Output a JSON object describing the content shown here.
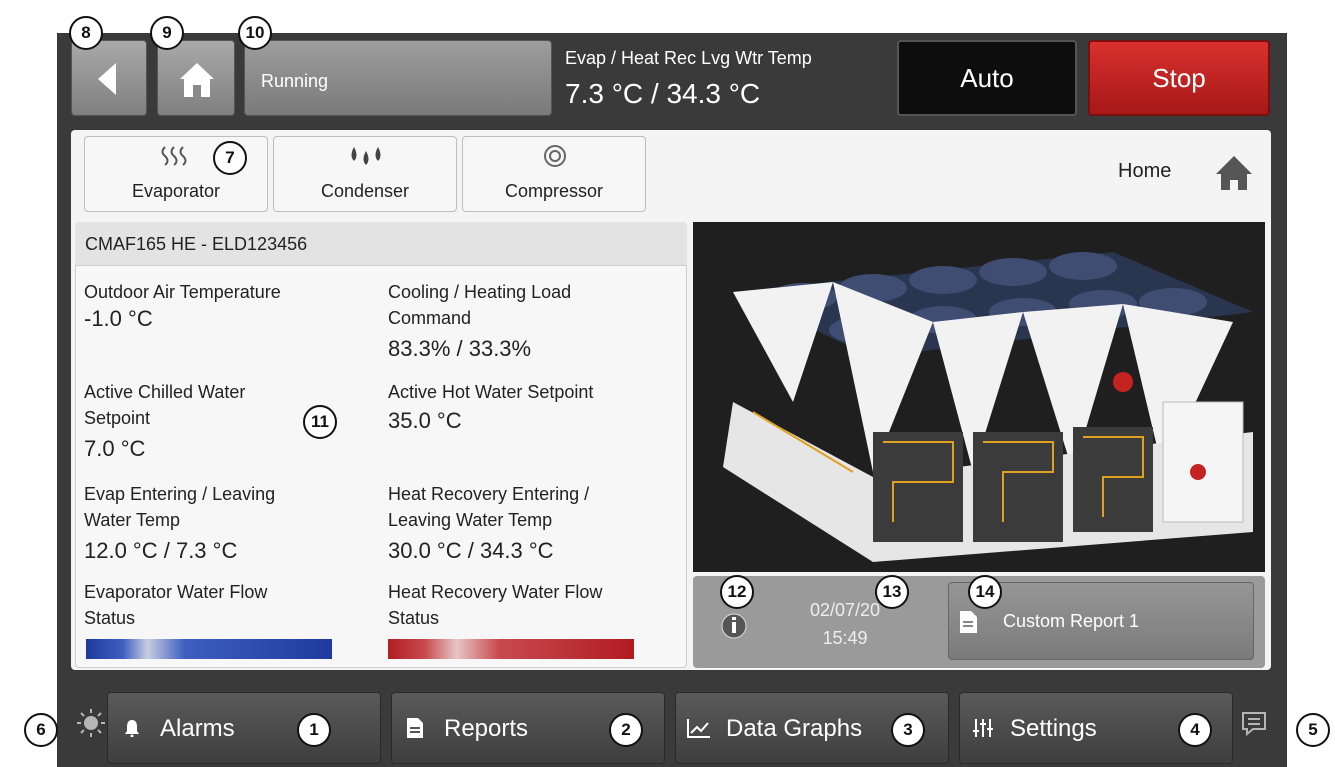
{
  "header": {
    "status_text": "Running",
    "temp_label": "Evap / Heat Rec Lvg Wtr Temp",
    "temp_value": "7.3 °C / 34.3 °C",
    "auto_label": "Auto",
    "stop_label": "Stop"
  },
  "tabs": [
    {
      "label": "Evaporator",
      "icon": "steam-icon"
    },
    {
      "label": "Condenser",
      "icon": "droplets-icon"
    },
    {
      "label": "Compressor",
      "icon": "spiral-icon"
    }
  ],
  "home_label": "Home",
  "unit": {
    "title": "CMAF165 HE - ELD123456",
    "outdoor_air_label": "Outdoor Air Temperature",
    "outdoor_air_value": "-1.0 °C",
    "load_label_1": "Cooling / Heating Load",
    "load_label_2": "Command",
    "load_value": "83.3% / 33.3%",
    "chilled_sp_label_1": "Active Chilled Water",
    "chilled_sp_label_2": "Setpoint",
    "chilled_sp_value": "7.0 °C",
    "hot_sp_label": "Active Hot Water Setpoint",
    "hot_sp_value": "35.0 °C",
    "evap_temp_label_1": "Evap Entering / Leaving",
    "evap_temp_label_2": "Water Temp",
    "evap_temp_value": "12.0 °C / 7.3 °C",
    "hr_temp_label_1": "Heat Recovery Entering /",
    "hr_temp_label_2": "Leaving Water Temp",
    "hr_temp_value": "30.0 °C / 34.3 °C",
    "evap_flow_label_1": "Evaporator Water Flow",
    "evap_flow_label_2": "Status",
    "hr_flow_label_1": "Heat Recovery Water Flow",
    "hr_flow_label_2": "Status"
  },
  "info": {
    "date": "02/07/20",
    "time": "15:49",
    "report_label": "Custom Report 1"
  },
  "bottom_nav": {
    "alarms": "Alarms",
    "reports": "Reports",
    "data_graphs": "Data Graphs",
    "settings": "Settings"
  },
  "callouts": [
    "1",
    "2",
    "3",
    "4",
    "5",
    "6",
    "7",
    "8",
    "9",
    "10",
    "11",
    "12",
    "13",
    "14"
  ],
  "colors": {
    "stop": "#c42322",
    "auto": "#0d0d0d",
    "evap_flow_bar": "#1e3a9c",
    "hr_flow_bar": "#b01c22"
  }
}
